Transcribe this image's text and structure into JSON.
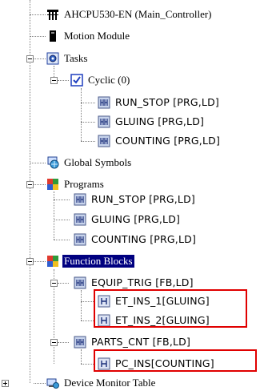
{
  "tree": {
    "controller": "AHCPU530-EN  (Main_Controller)",
    "motion_module": "Motion Module",
    "tasks": "Tasks",
    "cyclic": "Cyclic (0)",
    "task_items": [
      "RUN_STOP [PRG,LD]",
      "GLUING [PRG,LD]",
      "COUNTING [PRG,LD]"
    ],
    "global_symbols": "Global Symbols",
    "programs": "Programs",
    "program_items": [
      "RUN_STOP [PRG,LD]",
      "GLUING [PRG,LD]",
      "COUNTING [PRG,LD]"
    ],
    "function_blocks": "Function Blocks",
    "equip_trig": "EQUIP_TRIG [FB,LD]",
    "equip_trig_instances": [
      "ET_INS_1[GLUING]",
      "ET_INS_2[GLUING]"
    ],
    "parts_cnt": "PARTS_CNT [FB,LD]",
    "parts_cnt_instances": [
      "PC_INS[COUNTING]"
    ],
    "device_monitor_table": "Device Monitor Table"
  },
  "colors": {
    "selection": "#000080",
    "highlight_box": "#e00000",
    "tree_lines": "#808080"
  }
}
